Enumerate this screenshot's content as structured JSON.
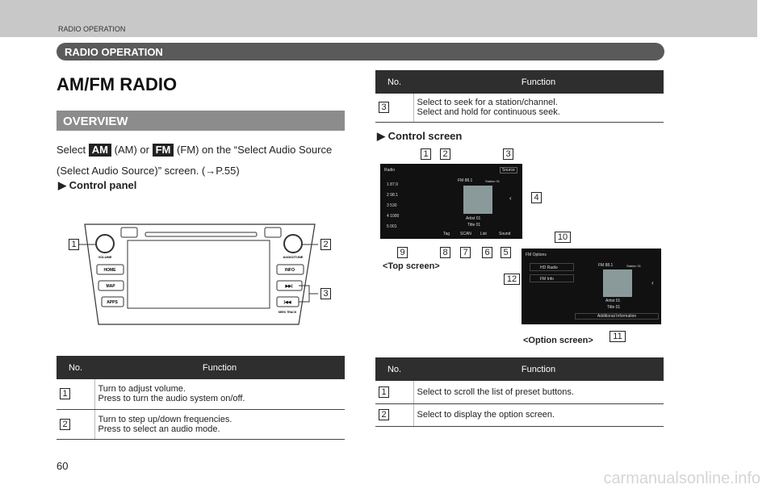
{
  "header": {
    "running_title": "RADIO OPERATION",
    "section_title": "RADIO OPERATION"
  },
  "page_title": "AM/FM RADIO",
  "overview": {
    "heading": "OVERVIEW",
    "text_1": "Select",
    "am_badge": "AM",
    "text_2": "(AM) or",
    "fm_badge": "FM",
    "text_3": "(FM) on the “Select Audio Source",
    "text_4": "(Select Audio Source)” screen. (→P.55)"
  },
  "control_panel": {
    "heading": "Control panel",
    "buttons": {
      "home": "HOME",
      "map": "MAP",
      "apps": "APPS",
      "info": "INFO",
      "volume": "VOLUME",
      "audio_tune": "AUDIO/TUNE",
      "seek_track": "SEEK TRACK"
    },
    "callouts": [
      "1",
      "2",
      "3"
    ]
  },
  "left_table": {
    "col_no": "No.",
    "col_function": "Function",
    "rows": [
      {
        "no": "1",
        "lines": [
          "Turn to adjust volume.",
          "Press to turn the audio system on/off."
        ]
      },
      {
        "no": "2",
        "lines": [
          "Turn to step up/down frequencies.",
          "Press to select an audio mode."
        ]
      }
    ]
  },
  "right_table_top": {
    "col_no": "No.",
    "col_function": "Function",
    "rows": [
      {
        "no": "3",
        "lines": [
          "Select to seek for a station/channel.",
          "Select and hold for continuous seek."
        ]
      }
    ]
  },
  "control_screen": {
    "heading": "Control screen",
    "top_screen": {
      "caption": "<Top screen>",
      "title": "Radio",
      "source": "Source",
      "station": "FM 88.1",
      "station_sub": "Station 01",
      "presets": [
        {
          "n": "1",
          "f": "87.9"
        },
        {
          "n": "2",
          "f": "98.1"
        },
        {
          "n": "3",
          "f": "530"
        },
        {
          "n": "4",
          "f": "1000"
        },
        {
          "n": "5",
          "f": "001"
        }
      ],
      "artist": "Artist 01",
      "track": "Title 01",
      "buttons": [
        "Tag",
        "SCAN",
        "List",
        "Sound"
      ]
    },
    "option_screen": {
      "caption": "<Option screen>",
      "title": "FM Options",
      "hd": "HD Radio",
      "info": "FM Info",
      "station": "FM 88.1",
      "station_sub": "Station 01",
      "artist": "Artist 01",
      "track": "Title 01",
      "additional": "Additional Information"
    },
    "callouts": [
      "1",
      "2",
      "3",
      "4",
      "5",
      "6",
      "7",
      "8",
      "9",
      "10",
      "11",
      "12"
    ]
  },
  "right_table_bottom": {
    "col_no": "No.",
    "col_function": "Function",
    "rows": [
      {
        "no": "1",
        "lines": [
          "Select to scroll the list of preset buttons."
        ]
      },
      {
        "no": "2",
        "lines": [
          "Select to display the option screen."
        ]
      }
    ]
  },
  "page_number": "60",
  "watermark": "carmanualsonline.info"
}
